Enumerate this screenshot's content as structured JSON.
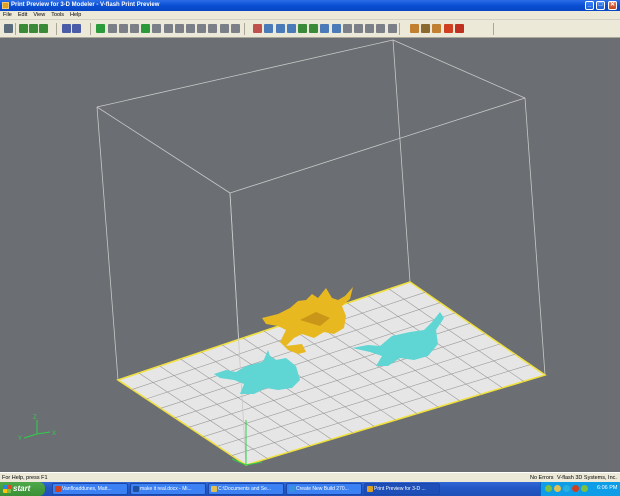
{
  "window": {
    "title": "Print Preview for 3-D Modeler - V-flash Print Preview",
    "minimize_glyph": "_",
    "maximize_glyph": "□",
    "close_glyph": "✕"
  },
  "menu": [
    "File",
    "Edit",
    "View",
    "Tools",
    "Help"
  ],
  "toolbar": {
    "icons": [
      {
        "name": "print-icon",
        "color": "#5a6b7a"
      },
      {
        "name": "zoom-in-icon",
        "color": "#3a8a3a"
      },
      {
        "name": "zoom-fit-icon",
        "color": "#3a8a3a"
      },
      {
        "name": "zoom-out-icon",
        "color": "#3a8a3a"
      },
      {
        "name": "undo-icon",
        "color": "#4a5ca8"
      },
      {
        "name": "redo-icon",
        "color": "#4a5ca8"
      },
      {
        "name": "rotate-icon",
        "color": "#2a9a3a"
      },
      {
        "name": "view-front-icon",
        "color": "#7a7f88"
      },
      {
        "name": "view-back-icon",
        "color": "#7a7f88"
      },
      {
        "name": "view-left-icon",
        "color": "#7a7f88"
      },
      {
        "name": "move-icon",
        "color": "#2a9a3a"
      },
      {
        "name": "view-iso-1-icon",
        "color": "#7a7f88"
      },
      {
        "name": "view-iso-2-icon",
        "color": "#7a7f88"
      },
      {
        "name": "view-iso-3-icon",
        "color": "#7a7f88"
      },
      {
        "name": "view-iso-4-icon",
        "color": "#7a7f88"
      },
      {
        "name": "view-top-icon",
        "color": "#7a7f88"
      },
      {
        "name": "view-bottom-icon",
        "color": "#7a7f88"
      },
      {
        "name": "view-right-icon",
        "color": "#7a7f88"
      },
      {
        "name": "view-home-icon",
        "color": "#7a7f88"
      },
      {
        "name": "shade-icon",
        "color": "#c0504d"
      },
      {
        "name": "grid-icon",
        "color": "#4a7ab8"
      },
      {
        "name": "layout-icon",
        "color": "#4a7ab8"
      },
      {
        "name": "arrange-icon",
        "color": "#4a7ab8"
      },
      {
        "name": "orient-icon",
        "color": "#3a8a3a"
      },
      {
        "name": "scale-icon",
        "color": "#3a8a3a"
      },
      {
        "name": "mirror-icon",
        "color": "#4a7ab8"
      },
      {
        "name": "duplicate-icon",
        "color": "#4a7ab8"
      },
      {
        "name": "select-icon",
        "color": "#7a7f88"
      },
      {
        "name": "measure-icon",
        "color": "#7a7f88"
      },
      {
        "name": "cut-icon",
        "color": "#7a7f88"
      },
      {
        "name": "paste-icon",
        "color": "#7a7f88"
      },
      {
        "name": "settings-icon",
        "color": "#7a7f88"
      },
      {
        "name": "tools-icon",
        "color": "#c08030"
      },
      {
        "name": "build-icon",
        "color": "#8a6a30"
      },
      {
        "name": "estimate-icon",
        "color": "#c08030"
      },
      {
        "name": "alert-icon",
        "color": "#d04020"
      },
      {
        "name": "stop-icon",
        "color": "#c03020"
      }
    ]
  },
  "viewport": {
    "background": "#6b6e72",
    "build_plate_color": "#e6e6e6",
    "plate_border_color": "#f0e040",
    "bounding_box_color": "#c8c8c8",
    "models": [
      {
        "name": "yellow-part",
        "color": "#e8b820"
      },
      {
        "name": "cyan-part-left",
        "color": "#5fd6d4"
      },
      {
        "name": "cyan-part-right",
        "color": "#5fd6d4"
      }
    ],
    "axes": {
      "x": "X",
      "y": "Y",
      "z": "Z",
      "color": "#2fd04a"
    }
  },
  "status": {
    "help": "For Help, press F1",
    "errors": "No Errors",
    "info": "V-flash  3D Systems, Inc."
  },
  "taskbar": {
    "start": "start",
    "tasks": [
      {
        "label": "Vanfloaddunes, Matt...",
        "color": "#d04020"
      },
      {
        "label": "make it real.docx - Mi...",
        "color": "#2050a0"
      },
      {
        "label": "C:\\Documents and Se...",
        "color": "#e0c050"
      },
      {
        "label": "Create New Build 270...",
        "color": "#3a90e0"
      },
      {
        "label": "Print Preview for 3-D ...",
        "color": "#e0a020"
      }
    ],
    "clock": "6:06 PM"
  }
}
